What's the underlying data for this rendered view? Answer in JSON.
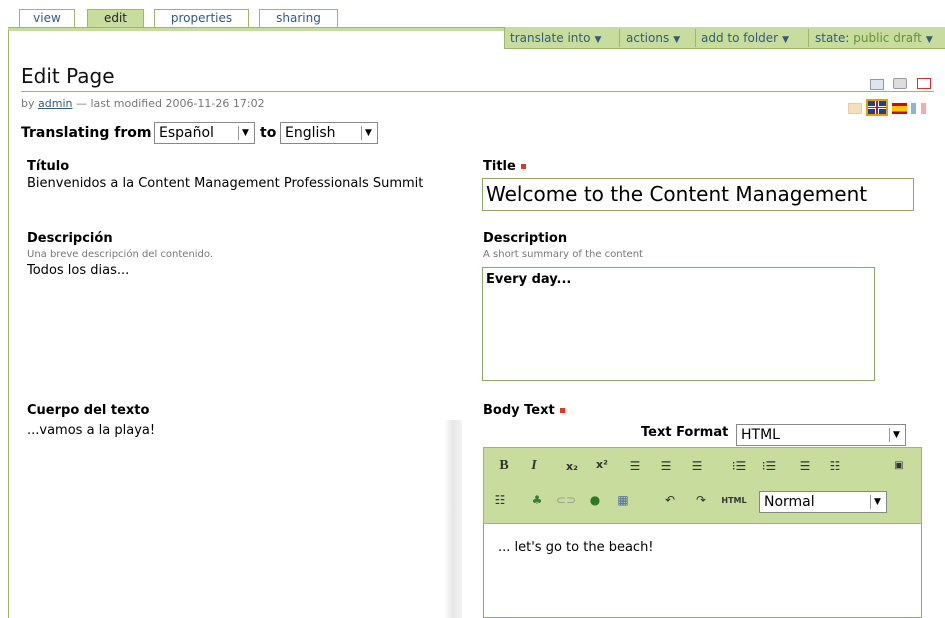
{
  "tabs": [
    {
      "label": "view",
      "active": false
    },
    {
      "label": "edit",
      "active": true
    },
    {
      "label": "properties",
      "active": false
    },
    {
      "label": "sharing",
      "active": false
    }
  ],
  "actions": {
    "translate_into": "translate into",
    "actions": "actions",
    "add_to_folder": "add to folder",
    "state_label": "state:",
    "state_value": "public draft"
  },
  "page": {
    "title": "Edit Page",
    "by_prefix": "by",
    "author": "admin",
    "modified": "— last modified 2006-11-26 17:02",
    "translating_from_label": "Translating from",
    "from_language": "Español",
    "to_label": "to",
    "to_language": "English"
  },
  "source": {
    "title_label": "Título",
    "title_value": "Bienvenidos a la Content Management Professionals Summit",
    "description_label": "Descripción",
    "description_help": "Una breve descripción del contenido.",
    "description_value": "Todos los dias...",
    "body_label": "Cuerpo del texto",
    "body_value": "...vamos a la playa!"
  },
  "target": {
    "title_label": "Title",
    "title_value": "Welcome to the Content Management",
    "description_label": "Description",
    "description_help": "A short summary of the content",
    "description_value": "Every day...",
    "body_label": "Body Text",
    "text_format_label": "Text Format",
    "text_format_value": "HTML",
    "style_value": "Normal",
    "body_value": "... let's go to the beach!"
  },
  "toolbar": {
    "bold": "B",
    "italic": "I",
    "subscript": "x₂",
    "superscript": "x²",
    "html": "HTML"
  },
  "colors": {
    "accent_green": "#c8dc9d",
    "border_green": "#9cb86b",
    "link_blue": "#34597f",
    "required_red": "#e03a1e"
  }
}
